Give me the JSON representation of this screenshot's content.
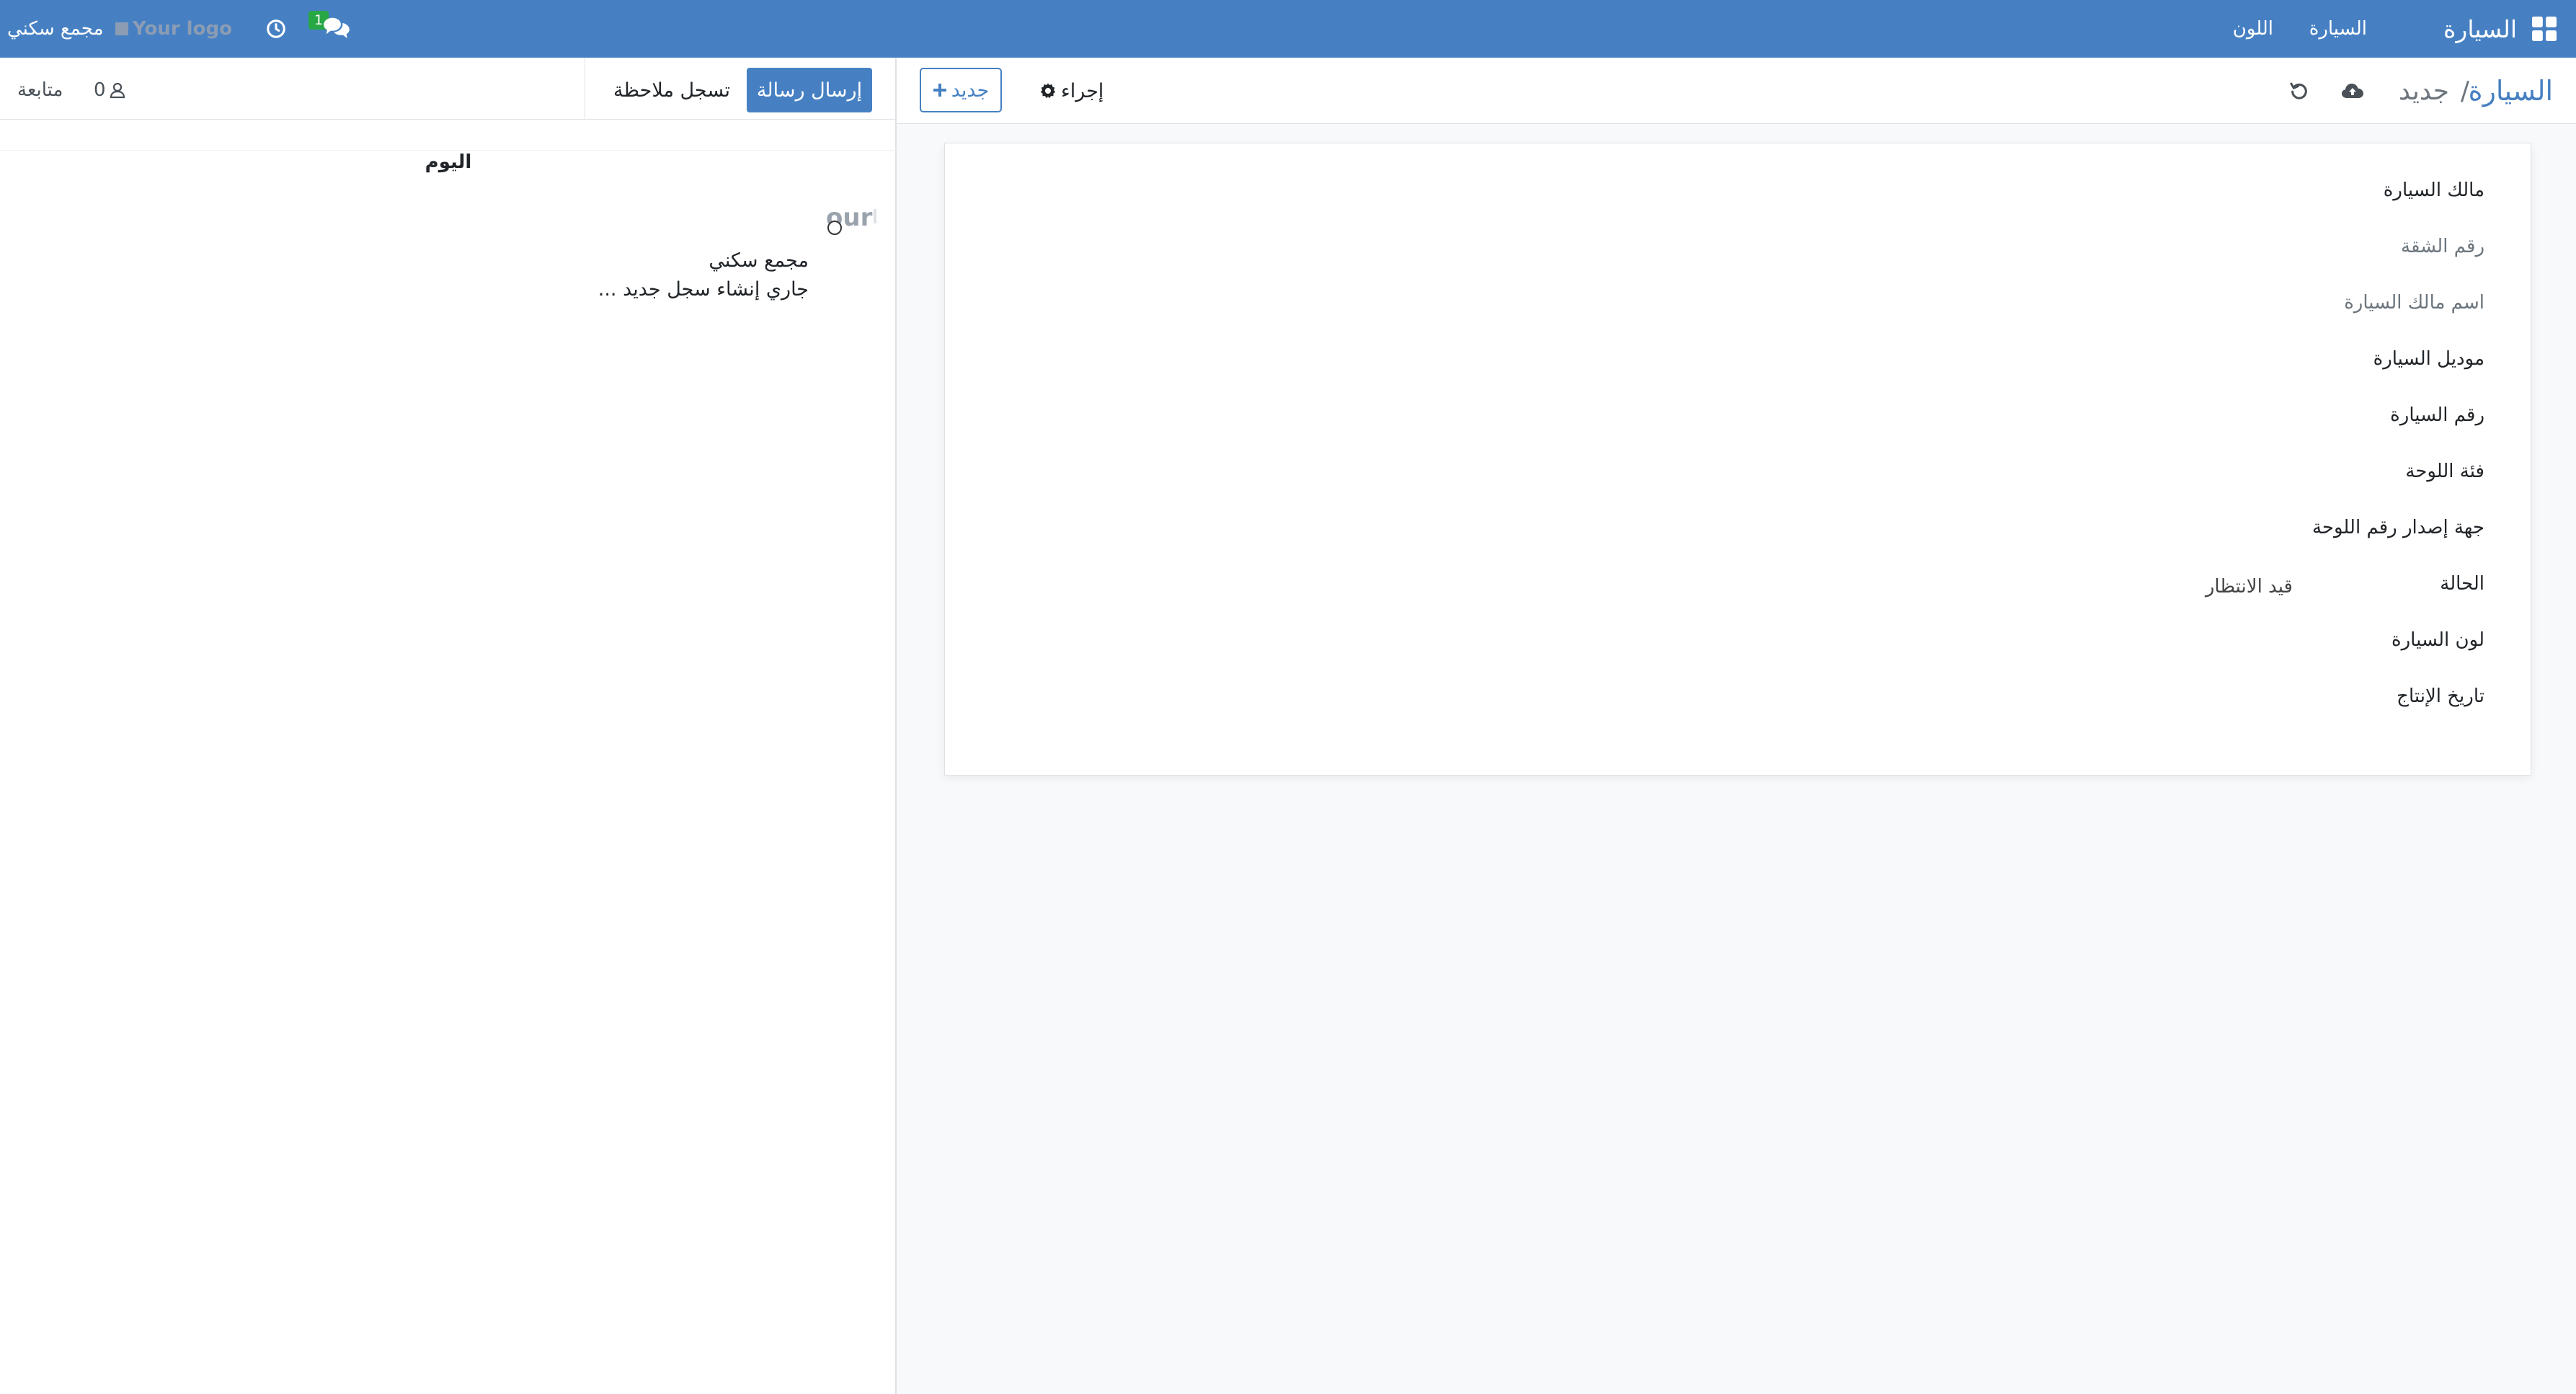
{
  "navbar": {
    "app_title": "السيارة",
    "menu_items": [
      "السيارة",
      "اللون"
    ],
    "user_name": "مجمع سكني",
    "logo_text": "Your logo",
    "message_count": "1",
    "icons": {
      "apps": "apps-grid-icon",
      "clock": "clock-icon",
      "chat": "chat-icon"
    }
  },
  "control_panel": {
    "breadcrumb_root": "السيارة",
    "breadcrumb_separator": "/",
    "breadcrumb_current": "جديد",
    "action_label": "إجراء",
    "new_label": "جديد"
  },
  "form": {
    "fields": [
      {
        "label": "مالك السيارة",
        "muted": false,
        "value": ""
      },
      {
        "label": "رقم الشقة",
        "muted": true,
        "value": ""
      },
      {
        "label": "اسم مالك السيارة",
        "muted": true,
        "value": ""
      },
      {
        "label": "موديل السيارة",
        "muted": false,
        "value": ""
      },
      {
        "label": "رقم السيارة",
        "muted": false,
        "value": ""
      },
      {
        "label": "فئة اللوحة",
        "muted": false,
        "value": ""
      },
      {
        "label": "جهة إصدار رقم اللوحة",
        "muted": false,
        "value": ""
      },
      {
        "label": "الحالة",
        "muted": false,
        "value": "قيد الانتظار"
      },
      {
        "label": "لون السيارة",
        "muted": false,
        "value": ""
      },
      {
        "label": "تاريخ الإنتاج",
        "muted": false,
        "value": ""
      }
    ]
  },
  "chatter": {
    "send_message_label": "إرسال رسالة",
    "log_note_label": "تسجل ملاحظة",
    "follow_label": "متابعة",
    "followers_count": "0",
    "day_label": "اليوم",
    "message": {
      "avatar_text": "our",
      "author": "مجمع سكني",
      "body": "جاري إنشاء سجل جديد ..."
    }
  },
  "colors": {
    "navbar_bg": "#4680c3",
    "primary": "#4680c3",
    "badge": "#28a745"
  }
}
